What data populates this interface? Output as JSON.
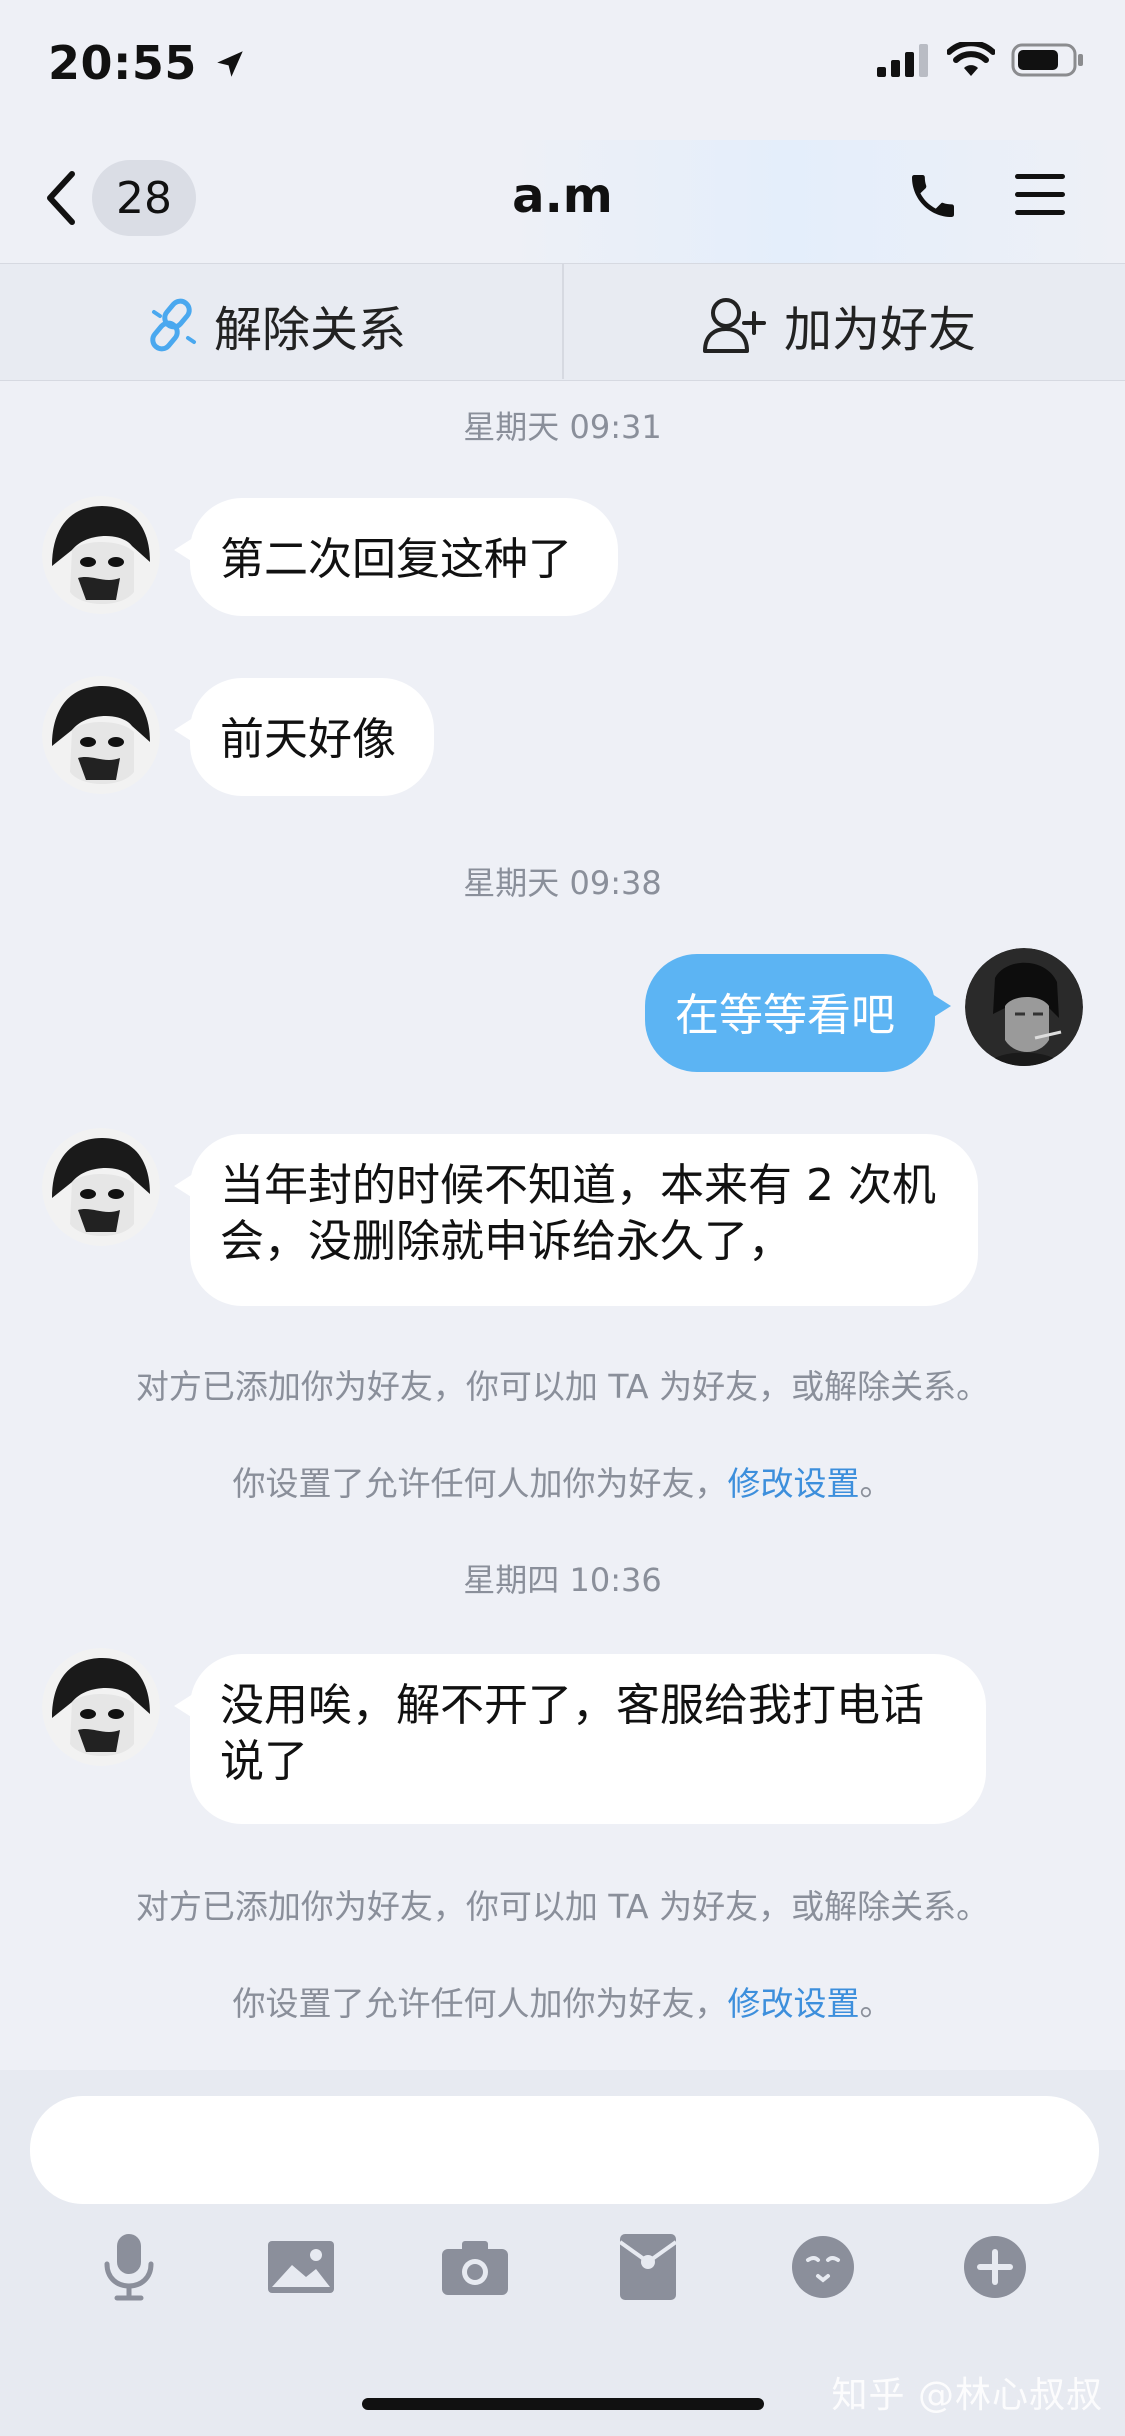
{
  "status": {
    "time": "20:55"
  },
  "nav": {
    "back_count": "28",
    "title": "a.m"
  },
  "actions": {
    "unlink": "解除关系",
    "add_friend": "加为好友"
  },
  "messages": {
    "ts1": "星期天 09:31",
    "m1": "第二次回复这种了",
    "m2": "前天好像",
    "ts2": "星期天 09:38",
    "m3": "在等等看吧",
    "m4_line1": "当年封的时候不知道，本来有 2 次机",
    "m4_line2": "会，没删除就申诉给永久了，",
    "sys1": "对方已添加你为好友，你可以加 TA 为好友，或解除关系。",
    "sys2_text": "你设置了允许任何人加你为好友，",
    "sys2_link": "修改设置",
    "sys2_end": "。",
    "ts3": "星期四 10:36",
    "m5_line1": "没用唉，解不开了，客服给我打电话",
    "m5_line2": "说了",
    "sys3": "对方已添加你为好友，你可以加 TA 为好友，或解除关系。",
    "sys4_text": "你设置了允许任何人加你为好友，",
    "sys4_link": "修改设置",
    "sys4_end": "。"
  },
  "input": {
    "placeholder": ""
  },
  "watermark": "知乎 @林心叔叔",
  "colors": {
    "outgoing_bubble": "#5cb4f3",
    "link": "#3d8fdc",
    "icon_gray": "#8b8f9b"
  }
}
